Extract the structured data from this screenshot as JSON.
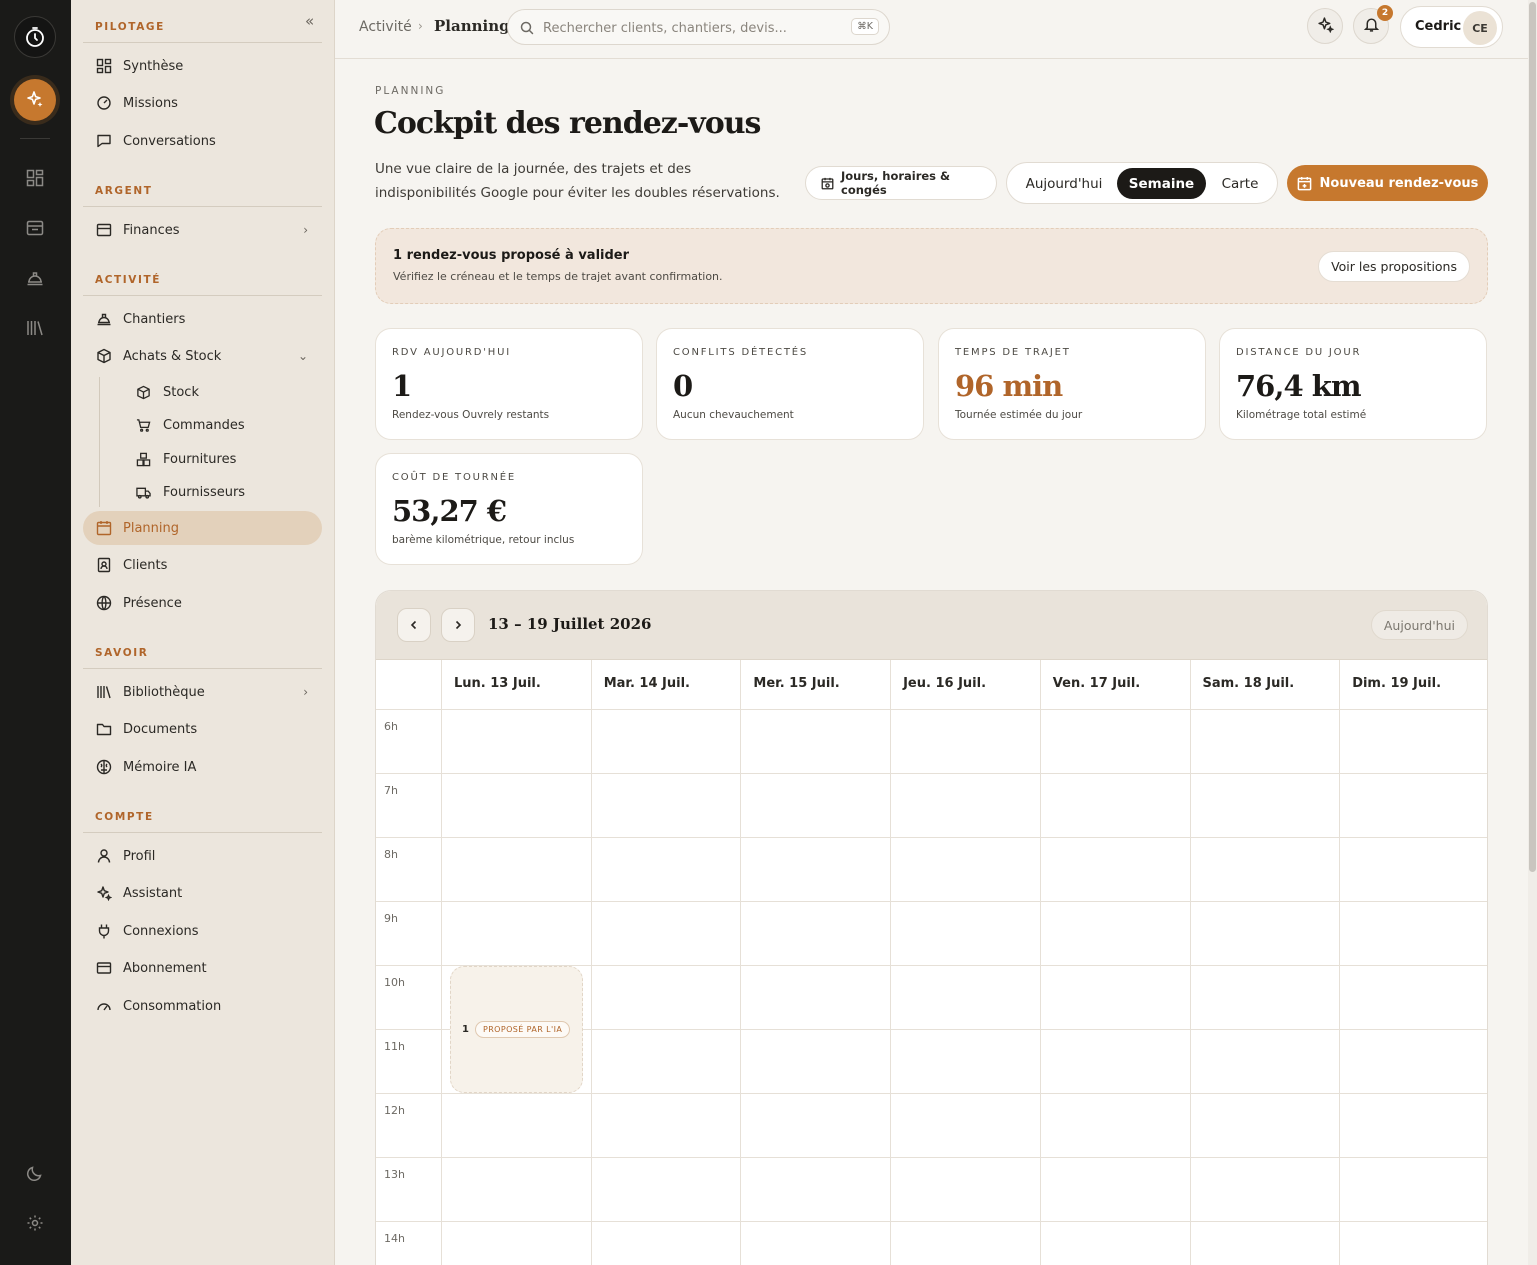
{
  "rail": {
    "icons": [
      "timer-icon",
      "sparkles-icon",
      "grid-icon",
      "inbox-icon",
      "helmet-icon",
      "library-icon",
      "moon-icon",
      "gear-icon"
    ]
  },
  "sidebar": {
    "sections": {
      "pilotage": "PILOTAGE",
      "argent": "ARGENT",
      "activite": "ACTIVITÉ",
      "savoir": "SAVOIR",
      "compte": "COMPTE"
    },
    "items": {
      "synthese": "Synthèse",
      "missions": "Missions",
      "conversations": "Conversations",
      "finances": "Finances",
      "chantiers": "Chantiers",
      "achats": "Achats & Stock",
      "stock": "Stock",
      "commandes": "Commandes",
      "fournitures": "Fournitures",
      "fournisseurs": "Fournisseurs",
      "planning": "Planning",
      "clients": "Clients",
      "presence": "Présence",
      "bibliotheque": "Bibliothèque",
      "documents": "Documents",
      "memoire": "Mémoire IA",
      "profil": "Profil",
      "assistant": "Assistant",
      "connexions": "Connexions",
      "abonnement": "Abonnement",
      "consommation": "Consommation"
    }
  },
  "topbar": {
    "breadcrumb": [
      "Activité",
      "Planning"
    ],
    "search_placeholder": "Rechercher clients, chantiers, devis...",
    "search_shortcut": "⌘K",
    "notification_count": "2",
    "user_name": "Cedric",
    "user_initials": "CE"
  },
  "page": {
    "eyebrow": "PLANNING",
    "title": "Cockpit des rendez-vous",
    "subtitle": "Une vue claire de la journée, des trajets et des indisponibilités Google pour éviter les doubles réservations.",
    "hours_button": "Jours, horaires & congés",
    "view_options": [
      "Aujourd'hui",
      "Semaine",
      "Carte"
    ],
    "active_view": "Semaine",
    "primary_button": "Nouveau rendez-vous"
  },
  "banner": {
    "title": "1 rendez-vous proposé à valider",
    "subtitle": "Vérifiez le créneau et le temps de trajet avant confirmation.",
    "button": "Voir les propositions"
  },
  "kpis": [
    {
      "label": "RDV AUJOURD'HUI",
      "value": "1",
      "desc": "Rendez-vous Ouvrely restants"
    },
    {
      "label": "CONFLITS DÉTECTÉS",
      "value": "0",
      "desc": "Aucun chevauchement"
    },
    {
      "label": "TEMPS DE TRAJET",
      "value": "96 min",
      "desc": "Tournée estimée du jour"
    },
    {
      "label": "DISTANCE DU JOUR",
      "value": "76,4 km",
      "desc": "Kilométrage total estimé"
    },
    {
      "label": "COÛT DE TOURNÉE",
      "value": "53,27 €",
      "desc": "barème kilométrique, retour inclus"
    }
  ],
  "calendar": {
    "range": "13 – 19 Juillet 2026",
    "today_button": "Aujourd'hui",
    "days": [
      "Lun. 13 Juil.",
      "Mar. 14 Juil.",
      "Mer. 15 Juil.",
      "Jeu. 16 Juil.",
      "Ven. 17 Juil.",
      "Sam. 18 Juil.",
      "Dim. 19 Juil."
    ],
    "hours": [
      "6h",
      "7h",
      "8h",
      "9h",
      "10h",
      "11h",
      "12h",
      "13h",
      "14h"
    ],
    "event": {
      "count": "1",
      "tag": "PROPOSÉ PAR L'IA"
    }
  },
  "colors": {
    "accent": "#c6782e",
    "rail": "#1a1a18",
    "sidebar": "#ece6dd",
    "background": "#f6f4f0"
  }
}
